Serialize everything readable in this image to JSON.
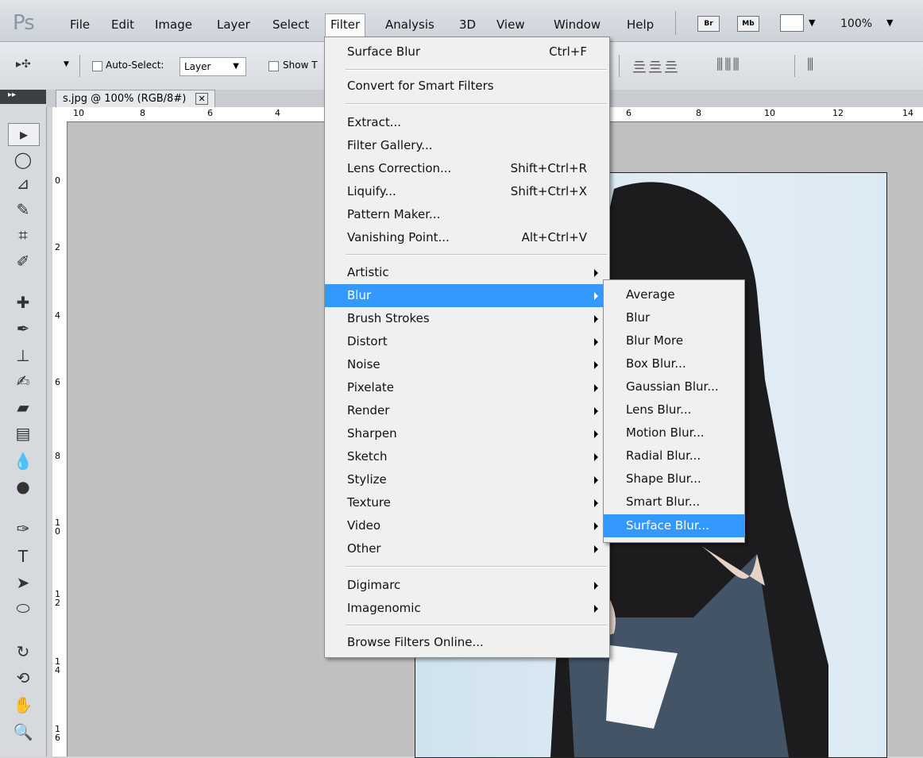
{
  "app": {
    "logo": "Ps"
  },
  "menubar": {
    "items": [
      "File",
      "Edit",
      "Image",
      "Layer",
      "Select",
      "Filter",
      "Analysis",
      "3D",
      "View",
      "Window",
      "Help"
    ],
    "active": "Filter",
    "bridge_label": "Br",
    "minibridge_label": "Mb",
    "zoom": "100%"
  },
  "options": {
    "auto_select_label": "Auto-Select:",
    "auto_select_value": "Layer",
    "show_label": "Show T"
  },
  "document": {
    "tab_title": "s.jpg @ 100% (RGB/8#)"
  },
  "rulers": {
    "h": [
      "10",
      "8",
      "6",
      "4",
      "6",
      "8",
      "10",
      "12",
      "14"
    ],
    "v": [
      "0",
      "2",
      "4",
      "6",
      "8",
      "1\n0",
      "1\n2",
      "1\n4",
      "1\n6"
    ]
  },
  "filter_menu": {
    "last_filter": {
      "label": "Surface Blur",
      "shortcut": "Ctrl+F"
    },
    "convert": "Convert for Smart Filters",
    "group1": [
      {
        "label": "Extract...",
        "shortcut": ""
      },
      {
        "label": "Filter Gallery...",
        "shortcut": ""
      },
      {
        "label": "Lens Correction...",
        "shortcut": "Shift+Ctrl+R"
      },
      {
        "label": "Liquify...",
        "shortcut": "Shift+Ctrl+X"
      },
      {
        "label": "Pattern Maker...",
        "shortcut": ""
      },
      {
        "label": "Vanishing Point...",
        "shortcut": "Alt+Ctrl+V"
      }
    ],
    "submenus": [
      "Artistic",
      "Blur",
      "Brush Strokes",
      "Distort",
      "Noise",
      "Pixelate",
      "Render",
      "Sharpen",
      "Sketch",
      "Stylize",
      "Texture",
      "Video",
      "Other"
    ],
    "highlighted": "Blur",
    "plugins": [
      "Digimarc",
      "Imagenomic"
    ],
    "browse": "Browse Filters Online..."
  },
  "blur_submenu": {
    "items": [
      "Average",
      "Blur",
      "Blur More",
      "Box Blur...",
      "Gaussian Blur...",
      "Lens Blur...",
      "Motion Blur...",
      "Radial Blur...",
      "Shape Blur...",
      "Smart Blur...",
      "Surface Blur..."
    ],
    "highlighted": "Surface Blur..."
  },
  "colors": {
    "highlight": "#3399ff",
    "menu_bg": "#f0f0f0"
  }
}
